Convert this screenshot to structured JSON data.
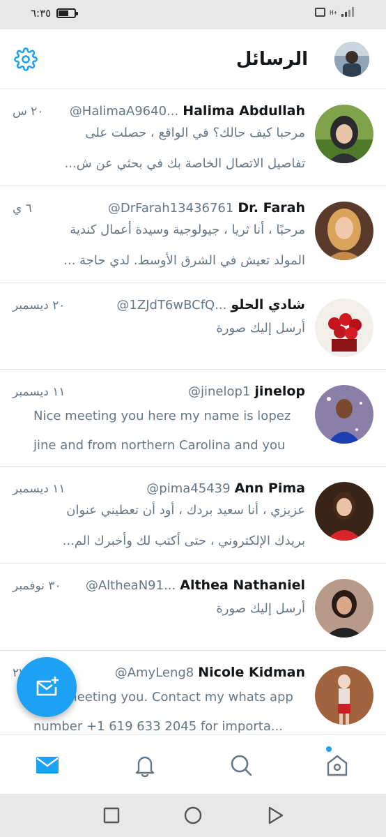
{
  "status_bar": {
    "time": "٦:٣٥",
    "network": "H+"
  },
  "header": {
    "title": "الرسائل"
  },
  "conversations": [
    {
      "name": "Halima Abdullah",
      "handle": "@HalimaA9640...",
      "time": "٢٠ س",
      "lines": [
        "مرحبا كيف حالك؟ في الواقع ، حصلت على",
        "تفاصيل الاتصال الخاصة بك في بحثي عن ش..."
      ]
    },
    {
      "name": "Dr. Farah",
      "handle": "@DrFarah13436761",
      "time": "٦ ي",
      "lines": [
        "مرحبًا ، أنا ثريا ، جيولوجية وسيدة أعمال كندية",
        "المولد تعيش في الشرق الأوسط.  لدي حاجة ..."
      ]
    },
    {
      "name": "شادي الحلو",
      "handle": "@1ZJdT6wBCfQ...",
      "time": "٢٠ ديسمبر",
      "lines": [
        "أرسل إليك صورة"
      ]
    },
    {
      "name": "jinelop",
      "handle": "@jinelop1",
      "time": "١١ ديسمبر",
      "lines": [
        "Nice meeting you here my name is lopez",
        "jine and from northern Carolina and you"
      ]
    },
    {
      "name": "Ann Pima",
      "handle": "@pima45439",
      "time": "١١ ديسمبر",
      "lines": [
        "عزيزي ، أنا سعيد بردك ، أود أن تعطيني عنوان",
        "بريدك الإلكتروني ، حتى أكتب لك وأخبرك الم..."
      ]
    },
    {
      "name": "Althea Nathaniel",
      "handle": "@AltheaN91...",
      "time": "٣٠ نوفمبر",
      "lines": [
        "أرسل إليك صورة"
      ]
    },
    {
      "name": "Nicole Kidman",
      "handle": "@AmyLeng8",
      "time": "٢٧",
      "lines": [
        "Nice meeting you. Contact my whats app",
        "number +1 619 633 2045 for importa..."
      ]
    }
  ],
  "colors": {
    "accent": "#1da1f2",
    "secondary_text": "#657786",
    "divider": "#e1e8ed"
  },
  "icons": {
    "settings": "gear-icon",
    "compose": "new-message-icon",
    "messages_tab": "envelope-icon",
    "notifications_tab": "bell-icon",
    "search_tab": "search-icon",
    "home_tab": "home-icon",
    "nav_recent": "square-icon",
    "nav_home": "circle-icon",
    "nav_back": "triangle-icon"
  }
}
